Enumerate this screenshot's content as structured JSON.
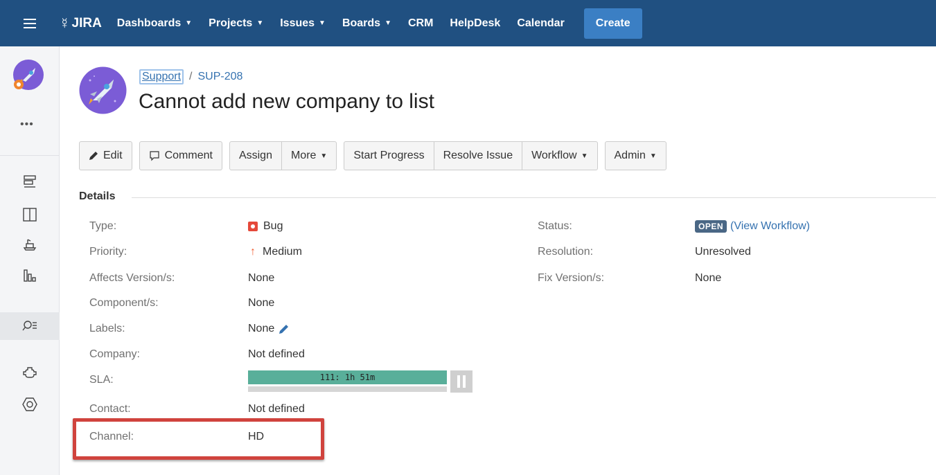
{
  "topnav": {
    "logo": "JIRA",
    "items": [
      {
        "label": "Dashboards",
        "dropdown": true
      },
      {
        "label": "Projects",
        "dropdown": true
      },
      {
        "label": "Issues",
        "dropdown": true
      },
      {
        "label": "Boards",
        "dropdown": true
      },
      {
        "label": "CRM",
        "dropdown": false
      },
      {
        "label": "HelpDesk",
        "dropdown": false
      },
      {
        "label": "Calendar",
        "dropdown": false
      }
    ],
    "create_label": "Create"
  },
  "sidebar": {
    "more_label": "•••",
    "icons": [
      "backlog-icon",
      "board-icon",
      "releases-icon",
      "reports-icon",
      "issues-search-icon",
      "add-ons-icon",
      "settings-icon"
    ]
  },
  "breadcrumb": {
    "project": "Support",
    "separator": "/",
    "issue_key": "SUP-208"
  },
  "issue": {
    "title": "Cannot add new company to list"
  },
  "toolbar": {
    "edit": "Edit",
    "comment": "Comment",
    "assign": "Assign",
    "more": "More",
    "start_progress": "Start Progress",
    "resolve": "Resolve Issue",
    "workflow": "Workflow",
    "admin": "Admin"
  },
  "details": {
    "heading": "Details",
    "type_label": "Type:",
    "type_value": "Bug",
    "priority_label": "Priority:",
    "priority_value": "Medium",
    "affects_label": "Affects Version/s:",
    "affects_value": "None",
    "components_label": "Component/s:",
    "components_value": "None",
    "labels_label": "Labels:",
    "labels_value": "None",
    "company_label": "Company:",
    "company_value": "Not defined",
    "sla_label": "SLA:",
    "sla_value": "111: 1h 51m",
    "contact_label": "Contact:",
    "contact_value": "Not defined",
    "channel_label": "Channel:",
    "channel_value": "HD",
    "status_label": "Status:",
    "status_value": "OPEN",
    "view_workflow": "(View Workflow)",
    "resolution_label": "Resolution:",
    "resolution_value": "Unresolved",
    "fix_label": "Fix Version/s:",
    "fix_value": "None"
  },
  "colors": {
    "nav": "#205081",
    "create": "#3b7fc4",
    "sla_bar": "#59af9a",
    "highlight": "#d0433d",
    "status_lozenge": "#4a6785"
  }
}
